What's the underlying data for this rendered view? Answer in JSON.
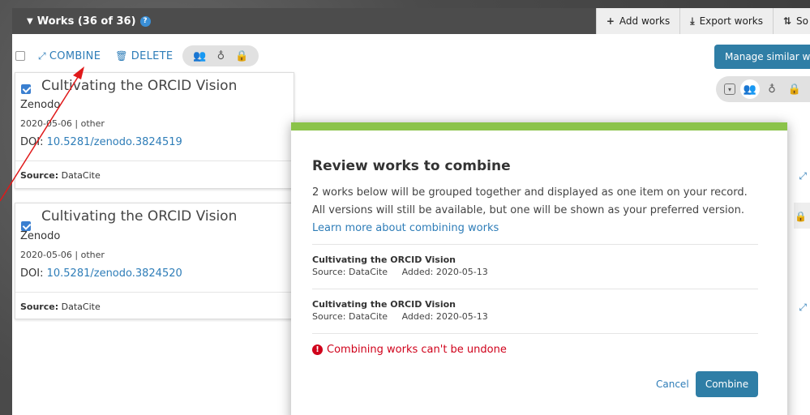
{
  "header": {
    "title": "Works (36 of 36)",
    "help": "?",
    "add_works": "Add works",
    "export_works": "Export works",
    "sort": "So"
  },
  "actions": {
    "combine": "COMBINE",
    "delete": "DELETE",
    "manage_similar": "Manage similar works"
  },
  "works": [
    {
      "title": "Cultivating the ORCID Vision",
      "publisher": "Zenodo",
      "date_type": "2020-05-06 | other",
      "doi_label": "DOI:",
      "doi": "10.5281/zenodo.3824519",
      "source_label": "Source:",
      "source": "DataCite",
      "checked": true
    },
    {
      "title": "Cultivating the ORCID Vision",
      "publisher": "Zenodo",
      "date_type": "2020-05-06 | other",
      "doi_label": "DOI:",
      "doi": "10.5281/zenodo.3824520",
      "source_label": "Source:",
      "source": "DataCite",
      "checked": true
    }
  ],
  "modal": {
    "title": "Review works to combine",
    "desc_line1": "2 works below will be grouped together and displayed as one item on your record.",
    "desc_line2": "All versions will still be available, but one will be shown as your preferred version.",
    "learn_more": "Learn more about combining works",
    "items": [
      {
        "title": "Cultivating the ORCID Vision",
        "source": "Source: DataCite",
        "added": "Added: 2020-05-13"
      },
      {
        "title": "Cultivating the ORCID Vision",
        "source": "Source: DataCite",
        "added": "Added: 2020-05-13"
      }
    ],
    "warning": "Combining works can't be undone",
    "cancel": "Cancel",
    "combine": "Combine"
  },
  "colors": {
    "accent_blue": "#2f7ea6",
    "link_blue": "#2e7db8",
    "modal_top": "#8bc34a",
    "warning_red": "#d0021b",
    "arrow_red": "#e0191a"
  }
}
